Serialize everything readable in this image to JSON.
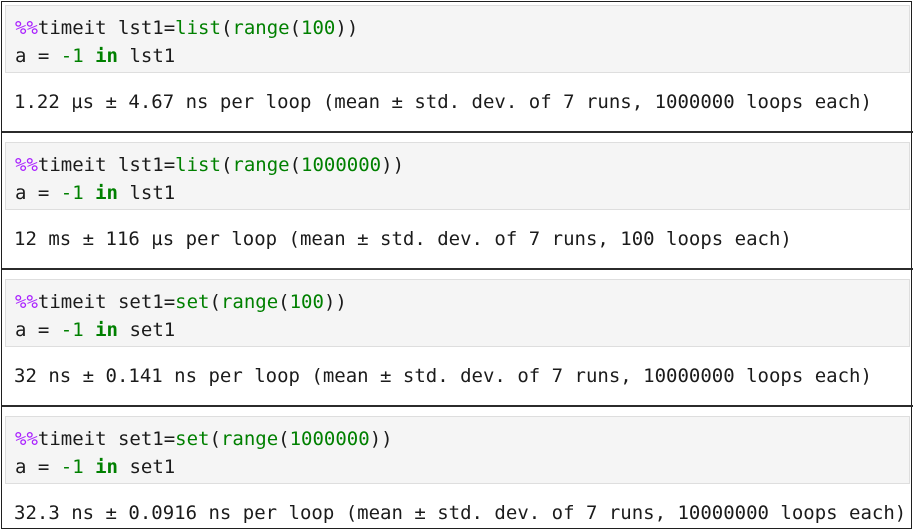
{
  "cells": [
    {
      "magic": "%%",
      "cmd": "timeit ",
      "var": "lst1=",
      "func": "list",
      "open_paren": "(",
      "inner_func": "range",
      "inner_open": "(",
      "arg": "100",
      "close_parens": "))",
      "line2_a": "a = ",
      "line2_neg": "-1",
      "line2_in": "in",
      "line2_target": " lst1",
      "output": "1.22 µs ± 4.67 ns per loop (mean ± std. dev. of 7 runs, 1000000 loops each)"
    },
    {
      "magic": "%%",
      "cmd": "timeit ",
      "var": "lst1=",
      "func": "list",
      "open_paren": "(",
      "inner_func": "range",
      "inner_open": "(",
      "arg": "1000000",
      "close_parens": "))",
      "line2_a": "a = ",
      "line2_neg": "-1",
      "line2_in": "in",
      "line2_target": " lst1",
      "output": "12 ms ± 116 µs per loop (mean ± std. dev. of 7 runs, 100 loops each)"
    },
    {
      "magic": "%%",
      "cmd": "timeit ",
      "var": "set1=",
      "func": "set",
      "open_paren": "(",
      "inner_func": "range",
      "inner_open": "(",
      "arg": "100",
      "close_parens": "))",
      "line2_a": "a = ",
      "line2_neg": "-1",
      "line2_in": "in",
      "line2_target": " set1",
      "output": "32 ns ± 0.141 ns per loop (mean ± std. dev. of 7 runs, 10000000 loops each)"
    },
    {
      "magic": "%%",
      "cmd": "timeit ",
      "var": "set1=",
      "func": "set",
      "open_paren": "(",
      "inner_func": "range",
      "inner_open": "(",
      "arg": "1000000",
      "close_parens": "))",
      "line2_a": "a = ",
      "line2_neg": "-1",
      "line2_in": "in",
      "line2_target": " set1",
      "output": "32.3 ns ± 0.0916 ns per loop (mean ± std. dev. of 7 runs, 10000000 loops each)"
    }
  ]
}
